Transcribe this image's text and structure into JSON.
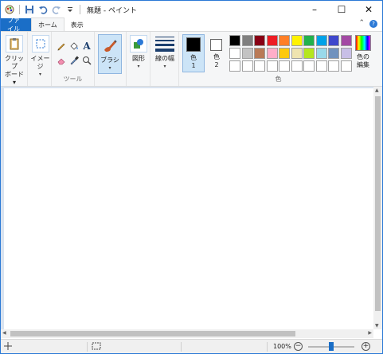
{
  "titlebar": {
    "title": "無題 - ペイント",
    "minimize": "–",
    "maximize": "☐",
    "close": "✕"
  },
  "tabs": {
    "file": "ファイル",
    "home": "ホーム",
    "view": "表示",
    "help": "?"
  },
  "ribbon": {
    "clipboard_label": "クリップ",
    "clipboard_label2": "ボード▾",
    "image_label": "イメージ",
    "image_arrow": "▾",
    "tools_label": "ツール",
    "brush_label": "ブラシ",
    "brush_arrow": "▾",
    "shapes_label": "図形",
    "shapes_arrow": "▾",
    "size_label": "線の幅",
    "size_arrow": "▾",
    "color1_label": "色",
    "color1_num": "1",
    "color2_label": "色",
    "color2_num": "2",
    "colors_group_label": "色",
    "edit_colors_label": "色の",
    "edit_colors_label2": "編集",
    "color1_value": "#000000",
    "color2_value": "#ffffff",
    "palette_row1": [
      "#000000",
      "#7f7f7f",
      "#880015",
      "#ed1c24",
      "#ff7f27",
      "#fff200",
      "#22b14c",
      "#00a2e8",
      "#3f48cc",
      "#a349a4"
    ],
    "palette_row2": [
      "#ffffff",
      "#c3c3c3",
      "#b97a57",
      "#ffaec9",
      "#ffc90e",
      "#efe4b0",
      "#b5e61d",
      "#99d9ea",
      "#7092be",
      "#c8bfe7"
    ],
    "palette_row3": [
      "#ffffff",
      "#ffffff",
      "#ffffff",
      "#ffffff",
      "#ffffff",
      "#ffffff",
      "#ffffff",
      "#ffffff",
      "#ffffff",
      "#ffffff"
    ]
  },
  "statusbar": {
    "zoom": "100%",
    "zoom_minus": "−",
    "zoom_plus": "+",
    "zoom_level": 0.5
  },
  "colors": {
    "accent": "#1a6ec7",
    "selected": "#cce4f7"
  }
}
